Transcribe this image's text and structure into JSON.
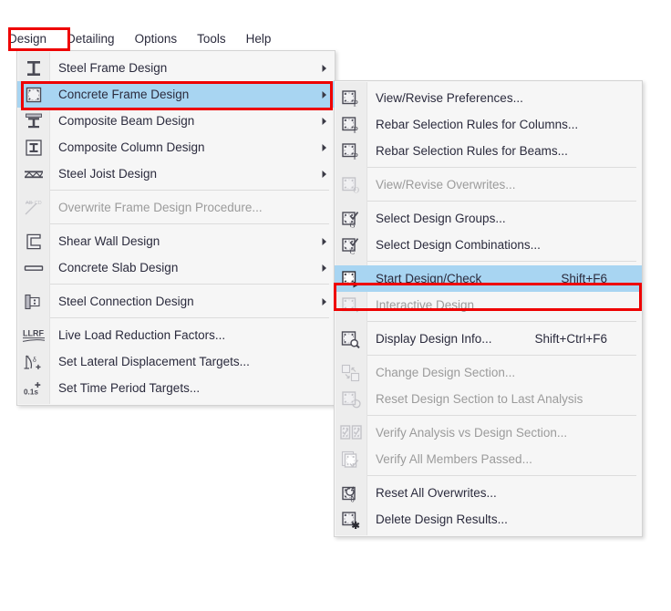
{
  "menubar": {
    "items": [
      {
        "label": "Design",
        "active": true
      },
      {
        "label": "Detailing",
        "active": false
      },
      {
        "label": "Options",
        "active": false
      },
      {
        "label": "Tools",
        "active": false
      },
      {
        "label": "Help",
        "active": false
      }
    ]
  },
  "design_menu": {
    "items": [
      {
        "label": "Steel Frame Design",
        "icon": "steel-frame-icon",
        "arrow": true,
        "disabled": false,
        "selected": false,
        "accel": ""
      },
      {
        "label": "Concrete Frame Design",
        "icon": "concrete-frame-icon",
        "arrow": true,
        "disabled": false,
        "selected": true,
        "accel": ""
      },
      {
        "label": "Composite Beam Design",
        "icon": "composite-beam-icon",
        "arrow": true,
        "disabled": false,
        "selected": false,
        "accel": ""
      },
      {
        "label": "Composite Column Design",
        "icon": "composite-column-icon",
        "arrow": true,
        "disabled": false,
        "selected": false,
        "accel": ""
      },
      {
        "label": "Steel Joist Design",
        "icon": "steel-joist-icon",
        "arrow": true,
        "disabled": false,
        "selected": false,
        "accel": ""
      },
      {
        "separator": true
      },
      {
        "label": "Overwrite Frame Design Procedure...",
        "icon": "overwrite-procedure-icon",
        "arrow": false,
        "disabled": true,
        "selected": false,
        "accel": ""
      },
      {
        "separator": true
      },
      {
        "label": "Shear Wall Design",
        "icon": "shear-wall-icon",
        "arrow": true,
        "disabled": false,
        "selected": false,
        "accel": ""
      },
      {
        "label": "Concrete Slab Design",
        "icon": "concrete-slab-icon",
        "arrow": true,
        "disabled": false,
        "selected": false,
        "accel": ""
      },
      {
        "separator": true
      },
      {
        "label": "Steel Connection Design",
        "icon": "steel-connection-icon",
        "arrow": true,
        "disabled": false,
        "selected": false,
        "accel": ""
      },
      {
        "separator": true
      },
      {
        "label": "Live Load Reduction Factors...",
        "icon": "llrf-icon",
        "arrow": false,
        "disabled": false,
        "selected": false,
        "accel": ""
      },
      {
        "label": "Set Lateral Displacement Targets...",
        "icon": "lateral-displacement-icon",
        "arrow": false,
        "disabled": false,
        "selected": false,
        "accel": ""
      },
      {
        "label": "Set Time Period Targets...",
        "icon": "time-period-icon",
        "arrow": false,
        "disabled": false,
        "selected": false,
        "accel": ""
      }
    ]
  },
  "concrete_submenu": {
    "items": [
      {
        "label": "View/Revise Preferences...",
        "icon": "preferences-icon",
        "disabled": false,
        "selected": false,
        "accel": ""
      },
      {
        "label": "Rebar Selection Rules for Columns...",
        "icon": "rebar-columns-icon",
        "disabled": false,
        "selected": false,
        "accel": ""
      },
      {
        "label": "Rebar Selection Rules for Beams...",
        "icon": "rebar-beams-icon",
        "disabled": false,
        "selected": false,
        "accel": ""
      },
      {
        "separator": true
      },
      {
        "label": "View/Revise Overwrites...",
        "icon": "overwrites-icon",
        "disabled": true,
        "selected": false,
        "accel": ""
      },
      {
        "separator": true
      },
      {
        "label": "Select Design Groups...",
        "icon": "design-groups-icon",
        "disabled": false,
        "selected": false,
        "accel": ""
      },
      {
        "label": "Select Design Combinations...",
        "icon": "design-combinations-icon",
        "disabled": false,
        "selected": false,
        "accel": ""
      },
      {
        "separator": true
      },
      {
        "label": "Start Design/Check",
        "icon": "start-design-icon",
        "disabled": false,
        "selected": true,
        "accel": "Shift+F6"
      },
      {
        "label": "Interactive Design",
        "icon": "interactive-design-icon",
        "disabled": true,
        "selected": false,
        "accel": ""
      },
      {
        "separator": true
      },
      {
        "label": "Display Design Info...",
        "icon": "display-design-info-icon",
        "disabled": false,
        "selected": false,
        "accel": "Shift+Ctrl+F6"
      },
      {
        "separator": true
      },
      {
        "label": "Change Design Section...",
        "icon": "change-design-section-icon",
        "disabled": true,
        "selected": false,
        "accel": ""
      },
      {
        "label": "Reset Design Section to Last Analysis",
        "icon": "reset-design-section-icon",
        "disabled": true,
        "selected": false,
        "accel": ""
      },
      {
        "separator": true
      },
      {
        "label": "Verify Analysis vs Design Section...",
        "icon": "verify-analysis-icon",
        "disabled": true,
        "selected": false,
        "accel": ""
      },
      {
        "label": "Verify All Members Passed...",
        "icon": "verify-members-icon",
        "disabled": true,
        "selected": false,
        "accel": ""
      },
      {
        "separator": true
      },
      {
        "label": "Reset All Overwrites...",
        "icon": "reset-overwrites-icon",
        "disabled": false,
        "selected": false,
        "accel": ""
      },
      {
        "label": "Delete Design Results...",
        "icon": "delete-results-icon",
        "disabled": false,
        "selected": false,
        "accel": ""
      }
    ]
  },
  "annotations": {
    "highlight_color": "#ee0000",
    "selection_color": "#a8d5f2",
    "boxes": [
      {
        "target": "menubar-item-design"
      },
      {
        "target": "design-menu-item-concrete-frame-design"
      },
      {
        "target": "submenu-item-start-design-check"
      }
    ]
  }
}
